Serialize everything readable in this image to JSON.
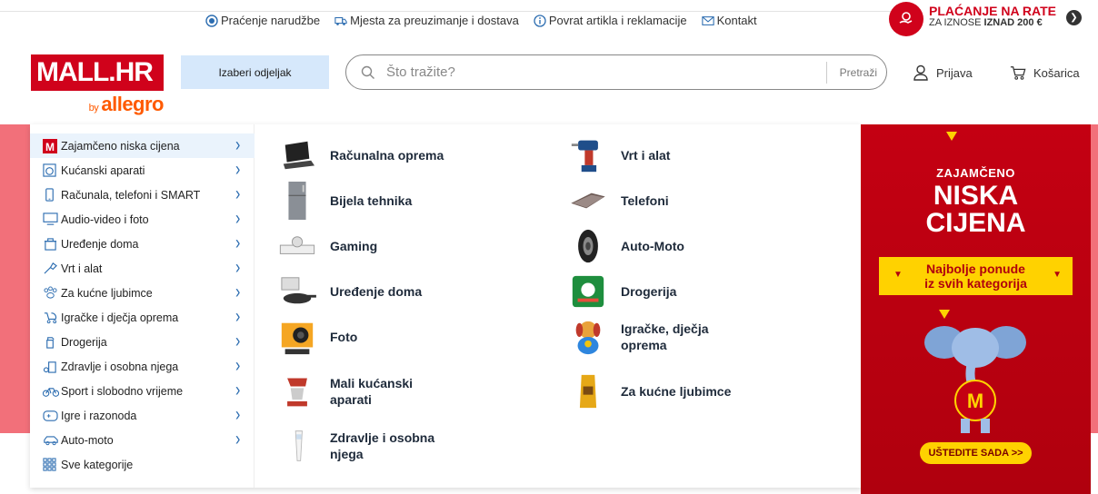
{
  "topbar": {
    "links": [
      {
        "label": "Praćenje narudžbe",
        "icon": "radio-target-icon"
      },
      {
        "label": "Mjesta za preuzimanje i dostava",
        "icon": "delivery-van-icon"
      },
      {
        "label": "Povrat artikla i reklamacije",
        "icon": "info-icon"
      },
      {
        "label": "Kontakt",
        "icon": "mail-icon"
      }
    ],
    "promo": {
      "title": "PLAĆANJE NA RATE",
      "sub_prefix": "ZA IZNOSE ",
      "sub_bold": "IZNAD 200 €"
    }
  },
  "header": {
    "logo_text": "MALL.HR",
    "logo_by": "by",
    "logo_brand": "allegro",
    "dept_button": "Izaberi odjeljak",
    "search_placeholder": "Što tražite?",
    "search_button": "Pretraži",
    "login": "Prijava",
    "cart": "Košarica"
  },
  "sidebar": {
    "items": [
      {
        "label": "Zajamčeno niska cijena",
        "icon": "mall-m-icon",
        "chevron": true
      },
      {
        "label": "Kućanski aparati",
        "icon": "washing-machine-icon",
        "chevron": true
      },
      {
        "label": "Računala, telefoni i SMART",
        "icon": "phone-icon",
        "chevron": true
      },
      {
        "label": "Audio-video i foto",
        "icon": "monitor-icon",
        "chevron": true
      },
      {
        "label": "Uređenje doma",
        "icon": "home-tools-icon",
        "chevron": true
      },
      {
        "label": "Vrt i alat",
        "icon": "garden-tools-icon",
        "chevron": true
      },
      {
        "label": "Za kućne ljubimce",
        "icon": "paw-icon",
        "chevron": true
      },
      {
        "label": "Igračke i dječja oprema",
        "icon": "stroller-icon",
        "chevron": true
      },
      {
        "label": "Drogerija",
        "icon": "spray-bottle-icon",
        "chevron": true
      },
      {
        "label": "Zdravlje i osobna njega",
        "icon": "health-icon",
        "chevron": true
      },
      {
        "label": "Sport i slobodno vrijeme",
        "icon": "bicycle-icon",
        "chevron": true
      },
      {
        "label": "Igre i razonoda",
        "icon": "gamepad-icon",
        "chevron": true
      },
      {
        "label": "Auto-moto",
        "icon": "car-icon",
        "chevron": true
      },
      {
        "label": "Sve kategorije",
        "icon": "grid-icon",
        "chevron": false
      }
    ]
  },
  "categories": {
    "col1": [
      {
        "label": "Računalna oprema",
        "icon": "laptop-icon"
      },
      {
        "label": "Bijela tehnika",
        "icon": "fridge-icon"
      },
      {
        "label": "Gaming",
        "icon": "game-console-icon"
      },
      {
        "label": "Uređenje doma",
        "icon": "cookware-icon"
      },
      {
        "label": "Foto",
        "icon": "action-camera-icon"
      },
      {
        "label": "Mali kućanski aparati",
        "icon": "stand-mixer-icon"
      },
      {
        "label": "Zdravlje i osobna njega",
        "icon": "thermometer-icon"
      }
    ],
    "col2": [
      {
        "label": "Vrt i alat",
        "icon": "drill-icon"
      },
      {
        "label": "Telefoni",
        "icon": "smartphone-icon"
      },
      {
        "label": "Auto-Moto",
        "icon": "tire-icon"
      },
      {
        "label": "Drogerija",
        "icon": "detergent-pack-icon"
      },
      {
        "label": "Igračke, dječja oprema",
        "icon": "toy-dog-icon"
      },
      {
        "label": "Za kućne ljubimce",
        "icon": "pet-food-icon"
      }
    ]
  },
  "banner": {
    "kicker": "ZAJAMČENO",
    "headline_1": "NISKA",
    "headline_2": "CIJENA",
    "strip_1": "Najbolje ponude",
    "strip_2": "iz svih kategorija",
    "cta": "UŠTEDITE SADA >>",
    "mascot_letter": "M"
  },
  "colors": {
    "brand_red": "#d0021b",
    "accent_blue": "#2b6cb0",
    "band_pink": "#f2707a",
    "promo_yellow": "#ffd200"
  }
}
